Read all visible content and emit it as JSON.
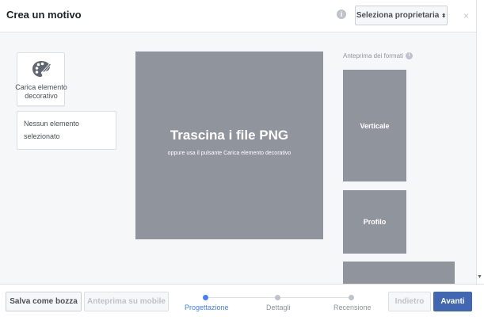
{
  "header": {
    "title": "Crea un motivo",
    "info_icon": "info-icon",
    "owner_select": "Seleziona proprietaria",
    "owner_caret": "⬍",
    "close": "×"
  },
  "left": {
    "upload_label": "Carica elemento decorativo",
    "selection_line1": "Nessun elemento",
    "selection_line2": "selezionato"
  },
  "dropzone": {
    "title": "Trascina i file PNG",
    "subtitle": "oppure usa il pulsante Carica elemento decorativo"
  },
  "preview": {
    "label": "Anteprima dei formati",
    "formats": [
      "Verticale",
      "Profilo",
      ""
    ]
  },
  "footer": {
    "save_draft": "Salva come bozza",
    "mobile_preview": "Anteprima su mobile",
    "back": "Indietro",
    "next": "Avanti"
  },
  "steps": [
    {
      "label": "Progettazione",
      "active": true
    },
    {
      "label": "Dettagli",
      "active": false
    },
    {
      "label": "Recensione",
      "active": false
    }
  ],
  "colors": {
    "accent": "#4080ff",
    "primary_button": "#4267b2",
    "placeholder_gray": "#90949c"
  }
}
